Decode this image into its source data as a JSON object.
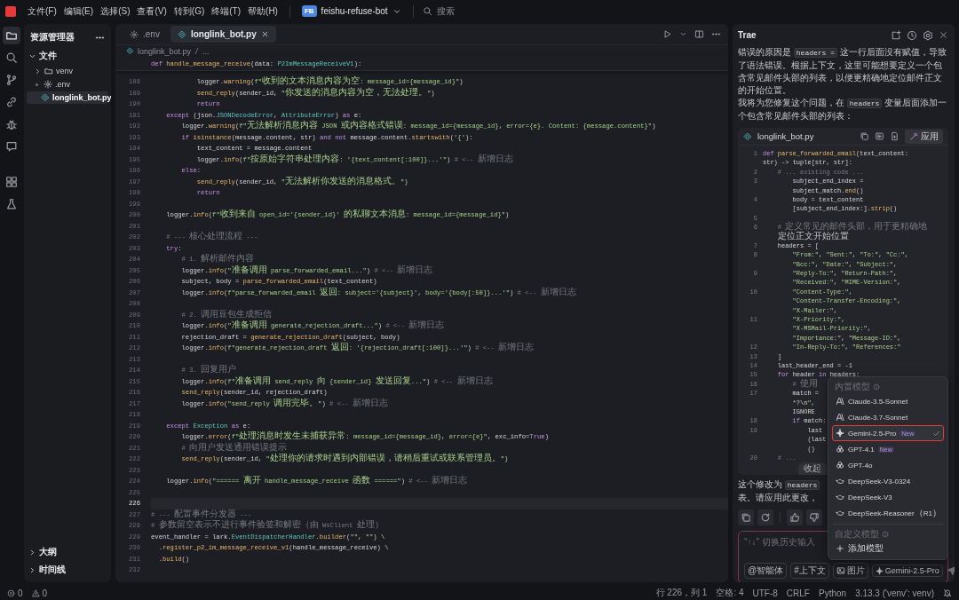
{
  "title_bar": {
    "menus": [
      "文件(F)",
      "编辑(E)",
      "选择(S)",
      "查看(V)",
      "转到(G)",
      "终端(T)",
      "帮助(H)"
    ],
    "project": {
      "badge": "FB",
      "name": "feishu-refuse-bot"
    },
    "search": {
      "placeholder": "搜索"
    }
  },
  "activity_bar": {
    "items": [
      {
        "kind": "files",
        "selected": true
      },
      {
        "kind": "search",
        "selected": false
      },
      {
        "kind": "branch",
        "selected": false
      },
      {
        "kind": "link",
        "selected": false
      },
      {
        "kind": "bug",
        "selected": false
      },
      {
        "kind": "chat",
        "selected": false
      }
    ],
    "tools": [
      {
        "kind": "grid",
        "selected": false
      },
      {
        "kind": "flask",
        "selected": false
      }
    ]
  },
  "explorer": {
    "title": "资源管理器",
    "tree": [
      {
        "kind": "section",
        "label": "文件",
        "expanded": true,
        "children": [
          {
            "kind": "folder",
            "label": "venv",
            "expanded": false,
            "selected": false
          },
          {
            "kind": "config",
            "label": ".env",
            "selected": false
          },
          {
            "kind": "python",
            "label": "longlink_bot.py",
            "selected": true
          }
        ]
      }
    ],
    "sections": [
      {
        "label": "大纲",
        "expanded": false
      },
      {
        "label": "时间线",
        "expanded": false
      }
    ]
  },
  "editor": {
    "tabs": [
      {
        "kind": "config",
        "label": ".env",
        "selected": false
      },
      {
        "kind": "python",
        "label": "longlink_bot.py",
        "selected": true
      }
    ],
    "breadcrumb": [
      "longlink_bot.py",
      "..."
    ],
    "sticky_line": "def handle_message_receive(data: P2ImMessageReceiveV1):",
    "lines": [
      {
        "n": "188",
        "text": "            logger.warning(f\"收到的文本消息内容为空: message_id={message_id}\")",
        "active": false
      },
      {
        "n": "189",
        "text": "            send_reply(sender_id, \"你发送的消息内容为空，无法处理。\")",
        "active": false
      },
      {
        "n": "190",
        "text": "            return",
        "active": false
      },
      {
        "n": "191",
        "text": "    except (json.JSONDecodeError, AttributeError) as e:",
        "active": false
      },
      {
        "n": "192",
        "text": "        logger.warning(f\"无法解析消息内容 JSON 或内容格式错误: message_id={message_id}, error={e}. Content: {message.content}\")",
        "active": false
      },
      {
        "n": "193",
        "text": "        if isinstance(message.content, str) and not message.content.startswith('{'):",
        "active": false
      },
      {
        "n": "194",
        "text": "            text_content = message.content",
        "active": false
      },
      {
        "n": "195",
        "text": "            logger.info(f\"按原始字符串处理内容: '{text_content[:100]}...'\") # <-- 新增日志",
        "active": false
      },
      {
        "n": "196",
        "text": "        else:",
        "active": false
      },
      {
        "n": "197",
        "text": "            send_reply(sender_id, \"无法解析你发送的消息格式。\")",
        "active": false
      },
      {
        "n": "198",
        "text": "            return",
        "active": false
      },
      {
        "n": "199",
        "active": false
      },
      {
        "n": "200",
        "text": "    logger.info(f\"收到来自 open_id='{sender_id}' 的私聊文本消息: message_id={message_id}\")",
        "active": false
      },
      {
        "n": "201",
        "active": false
      },
      {
        "n": "202",
        "text": "    # --- 核心处理流程 ---",
        "active": false
      },
      {
        "n": "203",
        "text": "    try:",
        "active": false
      },
      {
        "n": "204",
        "text": "        # 1. 解析邮件内容",
        "active": false
      },
      {
        "n": "205",
        "text": "        logger.info(\"准备调用 parse_forwarded_email...\") # <-- 新增日志",
        "active": false
      },
      {
        "n": "206",
        "text": "        subject, body = parse_forwarded_email(text_content)",
        "active": false
      },
      {
        "n": "207",
        "text": "        logger.info(f\"parse_forwarded_email 返回: subject='{subject}', body='{body[:50]}...'\") # <-- 新增日志",
        "active": false
      },
      {
        "n": "208",
        "active": false
      },
      {
        "n": "209",
        "text": "        # 2. 调用豆包生成拒信",
        "active": false
      },
      {
        "n": "210",
        "text": "        logger.info(\"准备调用 generate_rejection_draft...\") # <-- 新增日志",
        "active": false
      },
      {
        "n": "211",
        "text": "        rejection_draft = generate_rejection_draft(subject, body)",
        "active": false
      },
      {
        "n": "212",
        "text": "        logger.info(f\"generate_rejection_draft 返回: '{rejection_draft[:100]}...'\") # <-- 新增日志",
        "active": false
      },
      {
        "n": "213",
        "active": false
      },
      {
        "n": "214",
        "text": "        # 3. 回复用户",
        "active": false
      },
      {
        "n": "215",
        "text": "        logger.info(f\"准备调用 send_reply 向 {sender_id} 发送回复...\") # <-- 新增日志",
        "active": false
      },
      {
        "n": "216",
        "text": "        send_reply(sender_id, rejection_draft)",
        "active": false
      },
      {
        "n": "217",
        "text": "        logger.info(\"send_reply 调用完毕。\") # <-- 新增日志",
        "active": false
      },
      {
        "n": "218",
        "active": false
      },
      {
        "n": "219",
        "text": "    except Exception as e:",
        "active": false
      },
      {
        "n": "220",
        "text": "        logger.error(f\"处理消息时发生未捕获异常: message_id={message_id}, error={e}\", exc_info=True)",
        "active": false
      },
      {
        "n": "221",
        "text": "        # 向用户发送通用错误提示",
        "active": false
      },
      {
        "n": "222",
        "text": "        send_reply(sender_id, \"处理你的请求时遇到内部错误，请稍后重试或联系管理员。\")",
        "active": false
      },
      {
        "n": "223",
        "active": false
      },
      {
        "n": "224",
        "text": "    logger.info(\"====== 离开 handle_message_receive 函数 ======\") # <-- 新增日志",
        "active": false
      },
      {
        "n": "225",
        "active": false
      },
      {
        "n": "226",
        "active": true
      },
      {
        "n": "227",
        "text": "# --- 配置事件分发器 ---",
        "active": false
      },
      {
        "n": "228",
        "text": "# 参数留空表示不进行事件验签和解密（由 WsClient 处理）",
        "active": false
      },
      {
        "n": "229",
        "text": "event_handler = lark.EventDispatcherHandler.builder(\"\", \"\") \\",
        "active": false
      },
      {
        "n": "230",
        "text": "  .register_p2_im_message_receive_v1(handle_message_receive) \\",
        "active": false
      },
      {
        "n": "231",
        "text": "  .build()",
        "active": false
      },
      {
        "n": "232",
        "active": false
      }
    ]
  },
  "chat": {
    "title": "Trae",
    "message": [
      [
        {
          "kind": "text",
          "text": "错误的原因是 "
        },
        {
          "kind": "code",
          "text": "headers ="
        },
        {
          "kind": "text",
          "text": " 这一行后面没有赋值，导致了语法错误。根据上下文，这里可能想要定义一个包含常见邮件头部的列表，以便更精确地定位邮件正文的开始位置。"
        }
      ],
      [
        {
          "kind": "text",
          "text": "我将为您修复这个问题，在 "
        },
        {
          "kind": "code",
          "text": "headers"
        },
        {
          "kind": "text",
          "text": " 变量后面添加一个包含常见邮件头部的列表："
        }
      ]
    ],
    "code_block": {
      "file": "longlink_bot.py",
      "apply": "应用",
      "collapse": "收起",
      "lines": [
        {
          "n": "1",
          "rows": [
            "def parse_forwarded_email(text_content:",
            "str) -> tuple[str, str]:"
          ]
        },
        {
          "n": "2",
          "rows": [
            "    # ... existing code ..."
          ]
        },
        {
          "n": "3",
          "rows": [
            "        subject_end_index =",
            "        subject_match.end()"
          ]
        },
        {
          "n": "4",
          "rows": [
            "        body = text_content",
            "        [subject_end_index:].strip()"
          ]
        },
        {
          "n": "5"
        },
        {
          "n": "6",
          "rows": [
            "    # 定义常见的邮件头部，用于更精确地",
            "    定位正文开始位置"
          ]
        },
        {
          "n": "7",
          "rows": [
            "    headers = ["
          ]
        },
        {
          "n": "8",
          "rows": [
            "        \"From:\", \"Sent:\", \"To:\", \"Cc:\",",
            "        \"Bcc:\", \"Date:\", \"Subject:\","
          ]
        },
        {
          "n": "9",
          "rows": [
            "        \"Reply-To:\", \"Return-Path:\",",
            "        \"Received:\", \"MIME-Version:\","
          ]
        },
        {
          "n": "10",
          "rows": [
            "        \"Content-Type:\",",
            "        \"Content-Transfer-Encoding:\",",
            "        \"X-Mailer:\","
          ]
        },
        {
          "n": "11",
          "rows": [
            "        \"X-Priority:\",",
            "        \"X-MSMail-Priority:\",",
            "        \"Importance:\", \"Message-ID:\","
          ]
        },
        {
          "n": "12",
          "rows": [
            "        \"In-Reply-To:\", \"References:\""
          ]
        },
        {
          "n": "13",
          "rows": [
            "    ]"
          ]
        },
        {
          "n": "14",
          "rows": [
            "    last_header_end = -1"
          ]
        },
        {
          "n": "15",
          "rows": [
            "    for header in headers:"
          ]
        },
        {
          "n": "16",
          "rows": [
            "        # 使用"
          ]
        },
        {
          "n": "17",
          "rows": [
            "        match =",
            "        *?\\n\",",
            "        IGNORE"
          ]
        },
        {
          "n": "18",
          "rows": [
            "        if match:"
          ]
        },
        {
          "n": "19",
          "rows": [
            "            last",
            "            (last",
            "            ()"
          ]
        },
        {
          "n": "20",
          "rows": [
            "    # ..."
          ]
        }
      ]
    },
    "reply_lines": [
      [
        {
          "kind": "text",
          "text": "这个修改为 "
        },
        {
          "kind": "code",
          "text": "headers"
        }
      ],
      [
        {
          "kind": "text",
          "text": "表。请应用此更改，"
        }
      ]
    ],
    "input": {
      "placeholder": "\"↑↓\" 切换历史输入",
      "chips": [
        {
          "kind": "agent",
          "label": "@智能体"
        },
        {
          "kind": "context",
          "label": "#上下文"
        },
        {
          "kind": "image",
          "label": "图片"
        }
      ],
      "model": "Gemini-2.5-Pro"
    },
    "model_menu": {
      "sections": [
        {
          "title": "内置模型",
          "items": [
            {
              "kind": "anthropic",
              "label": "Claude-3.5-Sonnet",
              "selected": false
            },
            {
              "kind": "anthropic",
              "label": "Claude-3.7-Sonnet",
              "selected": false
            },
            {
              "kind": "gemini",
              "label": "Gemini-2.5-Pro",
              "badge": "New",
              "selected": true
            },
            {
              "kind": "openai",
              "label": "GPT-4.1",
              "badge": "New",
              "selected": false
            },
            {
              "kind": "openai",
              "label": "GPT-4o",
              "selected": false
            },
            {
              "kind": "deepseek",
              "label": "DeepSeek-V3-0324",
              "selected": false
            },
            {
              "kind": "deepseek",
              "label": "DeepSeek-V3",
              "selected": false
            },
            {
              "kind": "deepseek",
              "label": "DeepSeek-Reasoner（R1）",
              "selected": false
            }
          ]
        },
        {
          "title": "自定义模型",
          "items": [
            {
              "kind": "add",
              "label": "添加模型",
              "selected": false
            }
          ]
        }
      ]
    }
  },
  "status_bar": {
    "left": [
      {
        "kind": "error",
        "count": "0"
      },
      {
        "kind": "warning",
        "count": "0"
      }
    ],
    "right": [
      "行 226，列 1",
      "空格: 4",
      "UTF-8",
      "CRLF",
      "Python",
      "3.13.3 ('venv': venv)"
    ]
  }
}
